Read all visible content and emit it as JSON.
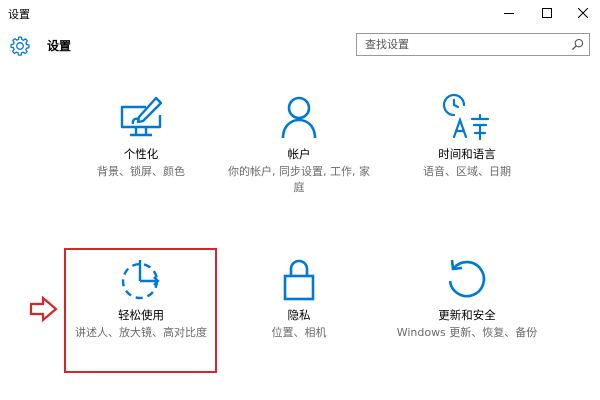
{
  "window": {
    "title": "设置",
    "controls": [
      "minimize",
      "maximize",
      "close"
    ]
  },
  "header": {
    "icon": "gear-icon",
    "title": "设置"
  },
  "search": {
    "placeholder": "查找设置",
    "value": "",
    "icon": "search-icon"
  },
  "colors": {
    "accent": "#0078d7",
    "annotation": "#d9242a",
    "title_text": "#000000",
    "desc_text": "#6b6b6b"
  },
  "tiles": [
    {
      "id": "personalization",
      "icon": "personalization-icon",
      "title": "个性化",
      "description": "背景、锁屏、颜色"
    },
    {
      "id": "accounts",
      "icon": "user-icon",
      "title": "帐户",
      "description": "你的帐户, 同步设置, 工作, 家庭"
    },
    {
      "id": "time_language",
      "icon": "time-language-icon",
      "title": "时间和语言",
      "description": "语音、区域、日期"
    },
    {
      "id": "ease_of_access",
      "icon": "ease-of-access-icon",
      "title": "轻松使用",
      "description": "讲述人、放大镜、高对比度"
    },
    {
      "id": "privacy",
      "icon": "lock-icon",
      "title": "隐私",
      "description": "位置、相机"
    },
    {
      "id": "update_security",
      "icon": "update-icon",
      "title": "更新和安全",
      "description": "Windows 更新、恢复、备份"
    }
  ],
  "annotations": {
    "highlighted_tile": "ease_of_access",
    "arrow_icon": "arrow-right-outline-icon"
  }
}
